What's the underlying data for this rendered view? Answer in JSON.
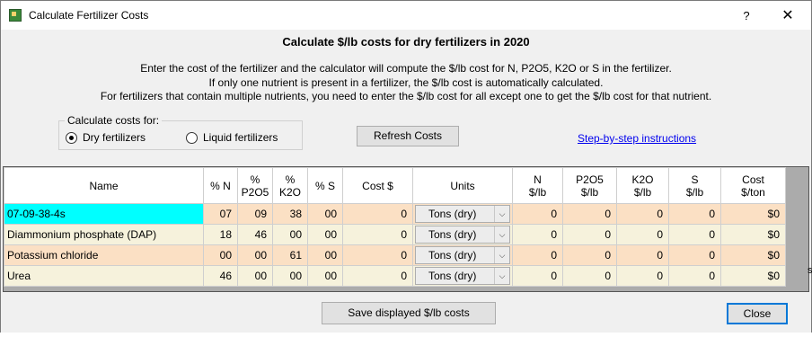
{
  "window": {
    "title": "Calculate Fertilizer Costs",
    "help_label": "?",
    "close_label": "✕"
  },
  "heading": "Calculate $/lb costs for dry fertilizers in 2020",
  "intro": [
    "Enter the cost of the fertilizer and the calculator will compute the $/lb cost for N, P2O5, K2O or S in the fertilizer.",
    "If only one nutrient is present in a fertilizer, the $/lb cost is automatically calculated.",
    "For fertilizers that contain multiple nutrients, you need to enter the $/lb cost for all except one to get the $/lb cost for that nutrient."
  ],
  "calc_for": {
    "legend": "Calculate costs for:",
    "options": [
      {
        "label": "Dry fertilizers",
        "selected": true
      },
      {
        "label": "Liquid fertilizers",
        "selected": false
      }
    ]
  },
  "refresh_label": "Refresh Costs",
  "instructions_link": "Step-by-step instructions",
  "table": {
    "headers": [
      [
        "Name"
      ],
      [
        "% N"
      ],
      [
        "%",
        "P2O5"
      ],
      [
        "%",
        "K2O"
      ],
      [
        "% S"
      ],
      [
        "Cost $"
      ],
      [
        "Units"
      ],
      [
        "N",
        "$/lb"
      ],
      [
        "P2O5",
        "$/lb"
      ],
      [
        "K2O",
        "$/lb"
      ],
      [
        "S",
        "$/lb"
      ],
      [
        "Cost",
        "$/ton"
      ]
    ],
    "rows": [
      {
        "name": "07-09-38-4s",
        "n": "07",
        "p": "09",
        "k": "38",
        "s": "00",
        "cost": "0",
        "units": "Tons (dry)",
        "n_lb": "0",
        "p_lb": "0",
        "k_lb": "0",
        "s_lb": "0",
        "ton": "$0"
      },
      {
        "name": "Diammonium phosphate (DAP)",
        "n": "18",
        "p": "46",
        "k": "00",
        "s": "00",
        "cost": "0",
        "units": "Tons (dry)",
        "n_lb": "0",
        "p_lb": "0",
        "k_lb": "0",
        "s_lb": "0",
        "ton": "$0"
      },
      {
        "name": "Potassium chloride",
        "n": "00",
        "p": "00",
        "k": "61",
        "s": "00",
        "cost": "0",
        "units": "Tons (dry)",
        "n_lb": "0",
        "p_lb": "0",
        "k_lb": "0",
        "s_lb": "0",
        "ton": "$0"
      },
      {
        "name": "Urea",
        "n": "46",
        "p": "00",
        "k": "00",
        "s": "00",
        "cost": "0",
        "units": "Tons (dry)",
        "n_lb": "0",
        "p_lb": "0",
        "k_lb": "0",
        "s_lb": "0",
        "ton": "$0"
      }
    ]
  },
  "save_label": "Save displayed $/lb costs",
  "close_label": "Close",
  "scroll_stub": "s",
  "icons": {
    "chevron": "chevron-down-icon",
    "app": "app-icon"
  },
  "colors": {
    "selected_cell": "#00ffff",
    "row_a": "#fbe0c4",
    "row_b": "#f6f2dc",
    "link": "#0000ee"
  }
}
